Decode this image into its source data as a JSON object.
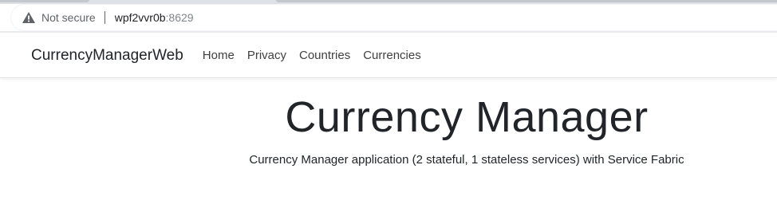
{
  "browser": {
    "security_label": "Not secure",
    "url_host": "wpf2vvr0b",
    "url_port": ":8629"
  },
  "navbar": {
    "brand": "CurrencyManagerWeb",
    "links": [
      "Home",
      "Privacy",
      "Countries",
      "Currencies"
    ]
  },
  "main": {
    "title": "Currency Manager",
    "lead": "Currency Manager application (2 stateful, 1 stateless services) with Service Fabric"
  },
  "colors": {
    "text_primary": "#212529",
    "nav_link": "#404040",
    "chrome_gray": "#5f6368"
  }
}
